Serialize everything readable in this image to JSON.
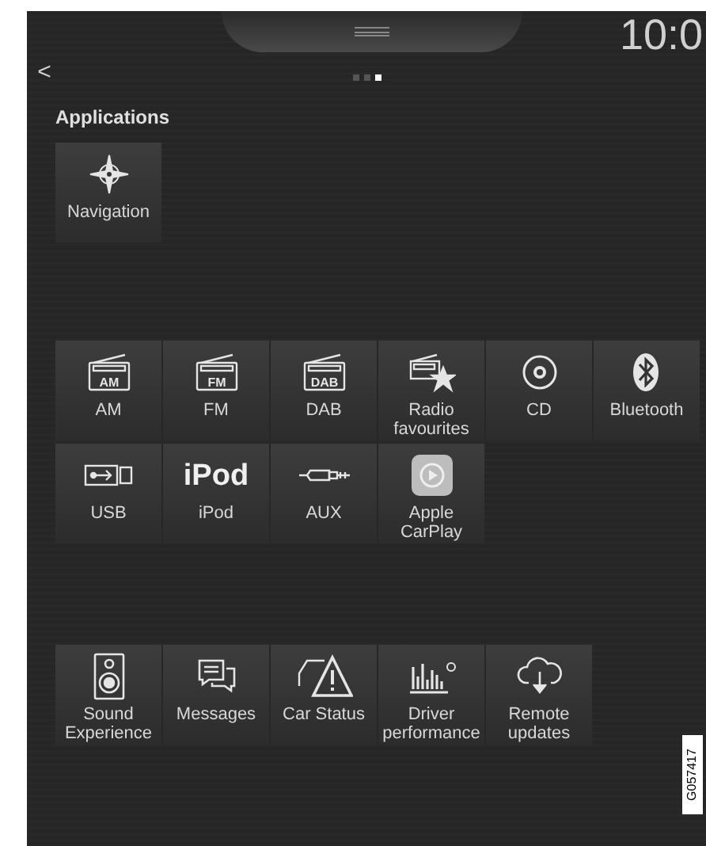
{
  "status_bar": {
    "time": "10:0"
  },
  "back": {
    "label": "<"
  },
  "page_dots": [
    {
      "selected": false
    },
    {
      "selected": false
    },
    {
      "selected": true
    }
  ],
  "title": "Applications",
  "sections": [
    {
      "rows": [
        [
          {
            "kind": "compass",
            "label": "Navigation"
          }
        ]
      ]
    },
    {
      "rows": [
        [
          {
            "kind": "radio",
            "icon_text": "AM",
            "label": "AM"
          },
          {
            "kind": "radio",
            "icon_text": "FM",
            "label": "FM"
          },
          {
            "kind": "radio",
            "icon_text": "DAB",
            "label": "DAB"
          },
          {
            "kind": "radio-star",
            "label": "Radio favourites"
          },
          {
            "kind": "disc",
            "label": "CD"
          },
          {
            "kind": "bluetooth",
            "label": "Bluetooth"
          }
        ],
        [
          {
            "kind": "usb",
            "label": "USB"
          },
          {
            "kind": "wordmark",
            "icon_text": "iPod",
            "label": "iPod"
          },
          {
            "kind": "plug",
            "label": "AUX"
          },
          {
            "kind": "play",
            "label": "Apple CarPlay"
          }
        ]
      ]
    },
    {
      "rows": [
        [
          {
            "kind": "speaker",
            "label": "Sound Experience"
          },
          {
            "kind": "chat",
            "label": "Messages"
          },
          {
            "kind": "warning",
            "label": "Car Status"
          },
          {
            "kind": "bars",
            "label": "Driver performance"
          },
          {
            "kind": "cloud",
            "label": "Remote updates"
          }
        ]
      ]
    }
  ],
  "figure_code": "G057417"
}
